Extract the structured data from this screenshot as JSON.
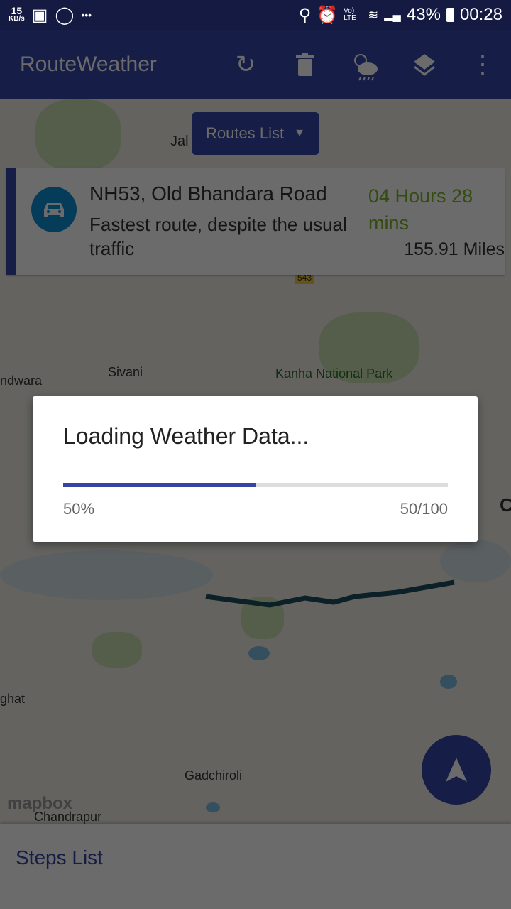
{
  "status_bar": {
    "net_speed": "15",
    "net_unit": "KB/s",
    "dots": "•••",
    "volte": "Vo) LTE",
    "battery": "43%",
    "time": "00:28"
  },
  "app_bar": {
    "title": "RouteWeather",
    "actions": [
      "refresh-icon",
      "delete-icon",
      "weather-icon",
      "layers-icon",
      "more-icon"
    ]
  },
  "routes_button": {
    "label": "Routes List"
  },
  "route_card": {
    "title": "NH53, Old Bhandara Road",
    "description": "Fastest route, despite the usual traffic",
    "duration": "04 Hours 28 mins",
    "distance": "155.91 Miles",
    "accent": "#7cb32a"
  },
  "map": {
    "labels": [
      "Jal",
      "Sivani",
      "Kanha National Park",
      "ndwara",
      "ghat",
      "Gadchiroli",
      "Chandrapur",
      "C"
    ],
    "road_shield": "543",
    "attribution": "mapbox"
  },
  "dialog": {
    "title": "Loading Weather Data...",
    "progress": 50,
    "percent_label": "50%",
    "count_label": "50/100"
  },
  "steps": {
    "label": "Steps List"
  },
  "colors": {
    "primary": "#3545a6",
    "status": "#151a42",
    "route": "#1d4d5e"
  }
}
